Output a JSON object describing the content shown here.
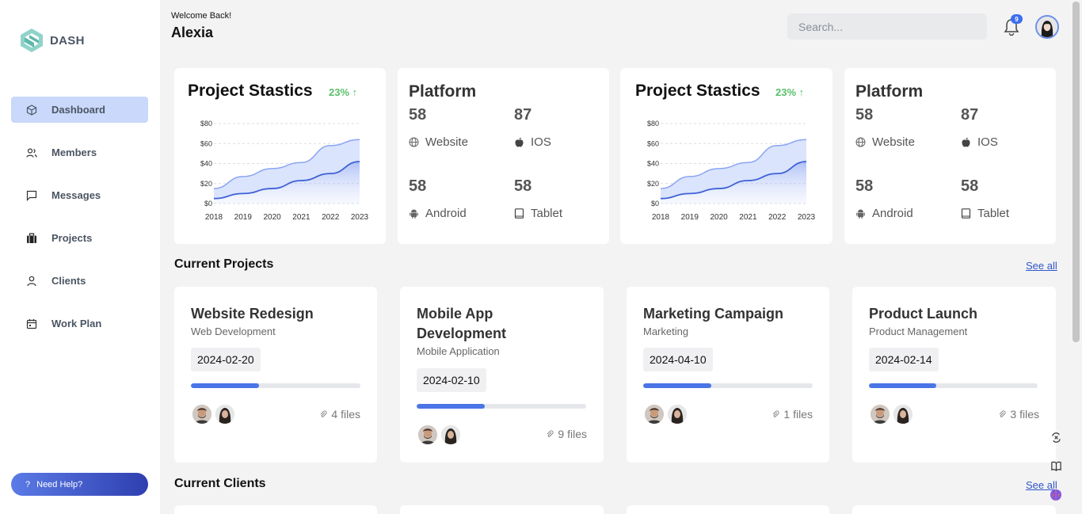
{
  "brand": {
    "name": "DASH"
  },
  "sidebar": {
    "items": [
      {
        "label": "Dashboard",
        "icon": "cube-icon",
        "active": true
      },
      {
        "label": "Members",
        "icon": "users-icon",
        "active": false
      },
      {
        "label": "Messages",
        "icon": "message-icon",
        "active": false
      },
      {
        "label": "Projects",
        "icon": "briefcase-icon",
        "active": false
      },
      {
        "label": "Clients",
        "icon": "user-icon",
        "active": false
      },
      {
        "label": "Work Plan",
        "icon": "calendar-icon",
        "active": false
      }
    ],
    "help_label": "Need Help?",
    "help_icon": "question-icon"
  },
  "header": {
    "welcome": "Welcome Back!",
    "username": "Alexia",
    "search_placeholder": "Search...",
    "notification_count": "9"
  },
  "stats": [
    {
      "title": "Project Stastics",
      "change": "23% ↑"
    },
    {
      "title": "Project Stastics",
      "change": "23% ↑"
    }
  ],
  "chart_data": [
    {
      "type": "area",
      "x": [
        "2018",
        "2019",
        "2020",
        "2021",
        "2022",
        "2023"
      ],
      "series": [
        {
          "values": [
            15,
            27,
            35,
            41,
            58,
            64
          ]
        },
        {
          "values": [
            5,
            10,
            15,
            23,
            30,
            42
          ]
        }
      ],
      "ylim": [
        0,
        80
      ],
      "yticks": [
        "$0",
        "$20",
        "$40",
        "$60",
        "$80"
      ],
      "grid": true
    },
    {
      "type": "area",
      "x": [
        "2018",
        "2019",
        "2020",
        "2021",
        "2022",
        "2023"
      ],
      "series": [
        {
          "values": [
            15,
            27,
            35,
            41,
            58,
            64
          ]
        },
        {
          "values": [
            5,
            10,
            15,
            23,
            30,
            42
          ]
        }
      ],
      "ylim": [
        0,
        80
      ],
      "yticks": [
        "$0",
        "$20",
        "$40",
        "$60",
        "$80"
      ],
      "grid": true
    }
  ],
  "platforms": [
    {
      "title": "Platform",
      "items": [
        {
          "value": "58",
          "label": "Website",
          "icon": "globe-icon"
        },
        {
          "value": "87",
          "label": "IOS",
          "icon": "apple-icon"
        },
        {
          "value": "58",
          "label": "Android",
          "icon": "android-icon"
        },
        {
          "value": "58",
          "label": "Tablet",
          "icon": "tablet-icon"
        }
      ]
    },
    {
      "title": "Platform",
      "items": [
        {
          "value": "58",
          "label": "Website",
          "icon": "globe-icon"
        },
        {
          "value": "87",
          "label": "IOS",
          "icon": "apple-icon"
        },
        {
          "value": "58",
          "label": "Android",
          "icon": "android-icon"
        },
        {
          "value": "58",
          "label": "Tablet",
          "icon": "tablet-icon"
        }
      ]
    }
  ],
  "projects_section": {
    "title": "Current Projects",
    "see_all": "See all"
  },
  "projects": [
    {
      "title": "Website Redesign",
      "category": "Web Development",
      "date": "2024-02-20",
      "progress": 0.4,
      "files": "4 files"
    },
    {
      "title": "Mobile App Development",
      "category": "Mobile Application",
      "date": "2024-02-10",
      "progress": 0.4,
      "files": "9 files"
    },
    {
      "title": "Marketing Campaign",
      "category": "Marketing",
      "date": "2024-04-10",
      "progress": 0.4,
      "files": "1 files"
    },
    {
      "title": "Product Launch",
      "category": "Product Management",
      "date": "2024-02-14",
      "progress": 0.4,
      "files": "3 files"
    }
  ],
  "clients_section": {
    "title": "Current Clients",
    "see_all": "See all"
  },
  "colors": {
    "accent": "#4b74e6",
    "active_nav": "#c9d8fb",
    "positive": "#5bbf6a",
    "help_gradient_start": "#5b7be6",
    "help_gradient_end": "#2f3fb0"
  }
}
